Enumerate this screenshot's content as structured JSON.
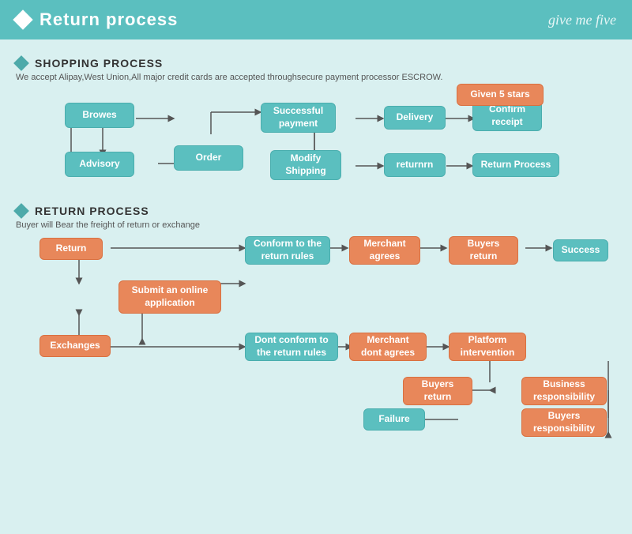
{
  "header": {
    "title": "Return process",
    "brand": "give me five",
    "diamond_label": "header-diamond"
  },
  "shopping_section": {
    "title": "SHOPPING PROCESS",
    "desc": "We accept Alipay,West Union,All major credit cards are accepted throughsecure payment processor ESCROW.",
    "boxes": {
      "browes": "Browes",
      "order": "Order",
      "advisory": "Advisory",
      "modify_shipping": "Modify\nShipping",
      "successful_payment": "Successful\npayment",
      "delivery": "Delivery",
      "confirm_receipt": "Confirm\nreceipt",
      "given_5_stars": "Given 5 stars",
      "returnrn": "returnrn",
      "return_process": "Return Process"
    }
  },
  "return_section": {
    "title": "RETURN PROCESS",
    "desc": "Buyer will Bear the freight of return or exchange",
    "boxes": {
      "return_btn": "Return",
      "exchanges": "Exchanges",
      "submit_online": "Submit an online\napplication",
      "conform_rules": "Conform to the\nreturn rules",
      "dont_conform_rules": "Dont conform to the\nreturn rules",
      "merchant_agrees": "Merchant\nagrees",
      "merchant_dont": "Merchant\ndont agrees",
      "buyers_return1": "Buyers\nreturn",
      "buyers_return2": "Buyers\nreturn",
      "success": "Success",
      "platform_intervention": "Platform\nintervention",
      "business_responsibility": "Business\nresponsibility",
      "buyers_responsibility": "Buyers\nresponsibility",
      "failure": "Failure"
    }
  }
}
